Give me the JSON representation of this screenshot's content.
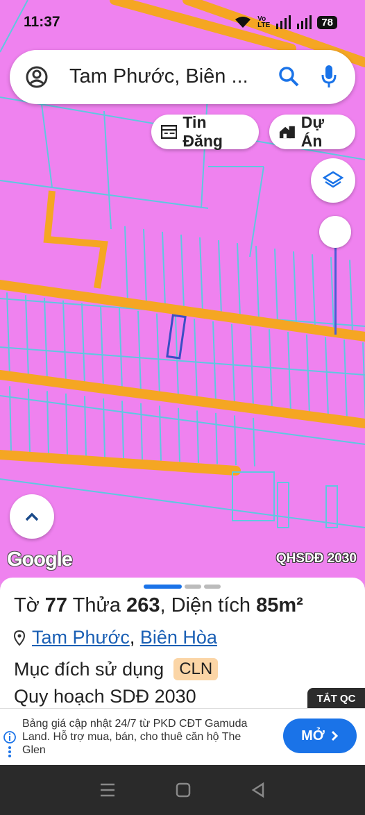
{
  "status": {
    "time": "11:37",
    "network_top": "Vo",
    "network_bottom": "LTE",
    "battery": "78"
  },
  "search": {
    "text": "Tam Phước, Biên ..."
  },
  "chips": {
    "listings": "Tin Đăng",
    "projects": "Dự Án"
  },
  "map": {
    "attribution": "Google",
    "layer": "QHSDĐ 2030"
  },
  "parcel": {
    "sheet_label": "Tờ",
    "sheet": "77",
    "plot_label": "Thửa",
    "plot": "263",
    "area_label": ", Diện tích",
    "area": "85m²",
    "ward": "Tam Phước",
    "separator": ",",
    "city": "Biên Hòa",
    "purpose_label": "Mục đích sử dụng",
    "purpose": "CLN",
    "plan": "Quy hoạch SDĐ 2030"
  },
  "ad": {
    "close_label": "TẮT QC",
    "text": "Bảng giá cập nhật 24/7 từ PKD CĐT Gamuda Land. Hỗ trợ mua, bán, cho thuê căn hộ The Glen",
    "cta": "MỞ"
  },
  "colors": {
    "land": "#ef82ef",
    "road": "#f5a623",
    "parcel_line": "#5ec8e0",
    "selected": "#3a4fc4",
    "accent": "#1a73e8"
  }
}
